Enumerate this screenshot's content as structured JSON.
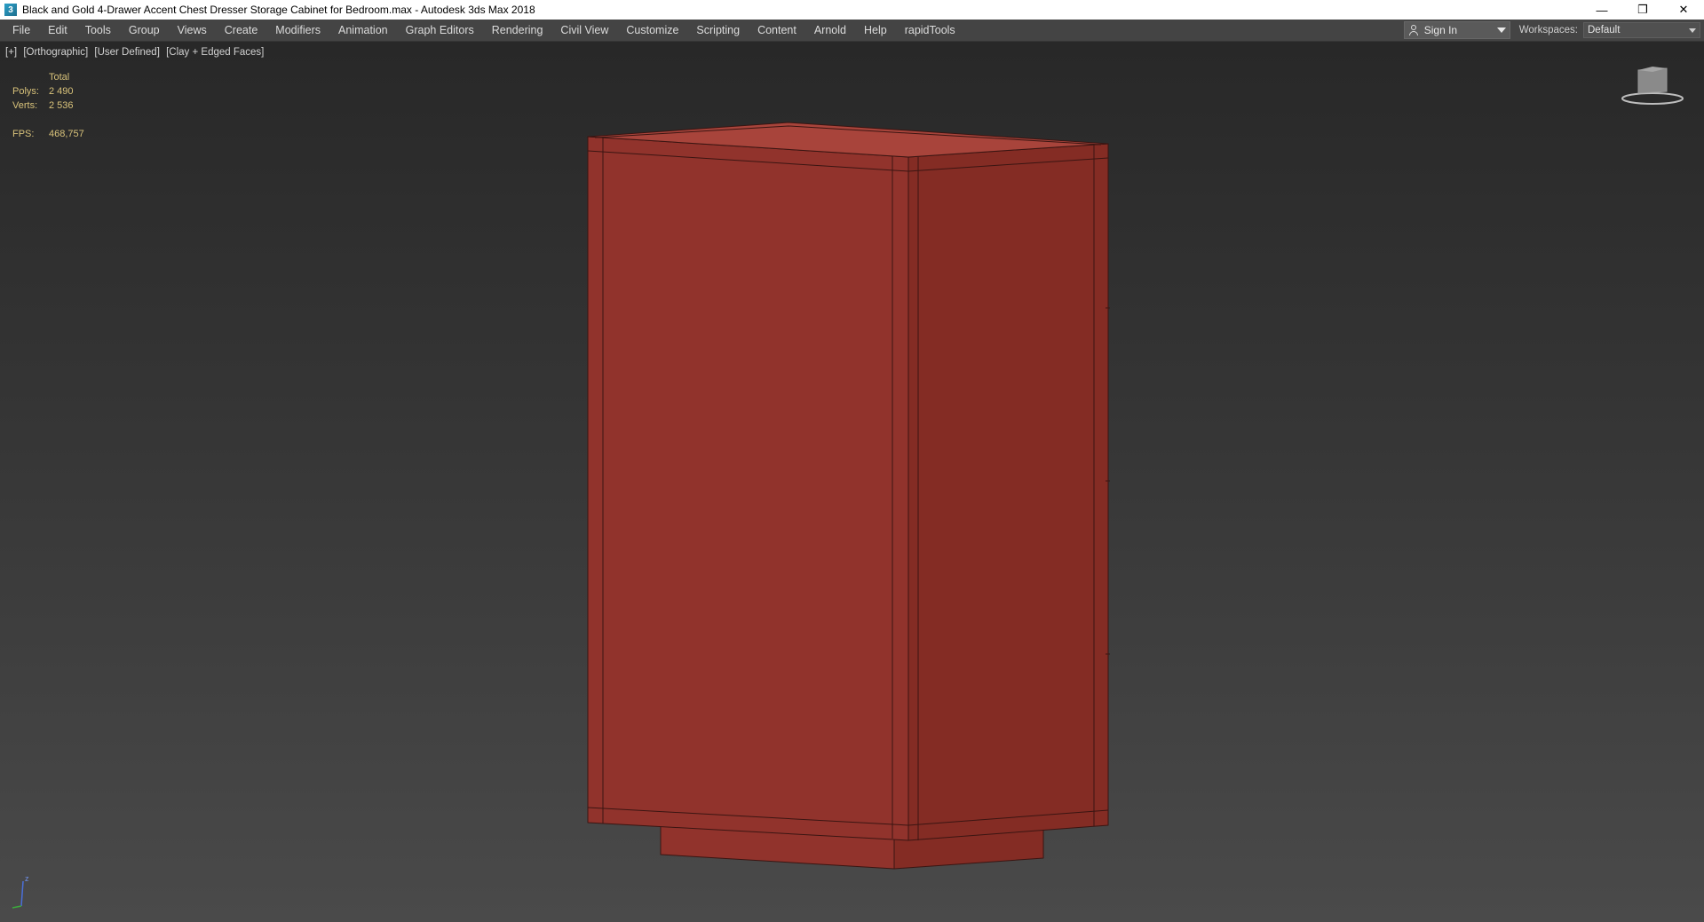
{
  "window": {
    "title": "Black and Gold 4-Drawer Accent Chest Dresser Storage Cabinet for Bedroom.max - Autodesk 3ds Max 2018",
    "app_icon_glyph": "3",
    "minimize_glyph": "—",
    "restore_glyph": "❐",
    "close_glyph": "✕"
  },
  "menu": {
    "items": [
      "File",
      "Edit",
      "Tools",
      "Group",
      "Views",
      "Create",
      "Modifiers",
      "Animation",
      "Graph Editors",
      "Rendering",
      "Civil View",
      "Customize",
      "Scripting",
      "Content",
      "Arnold",
      "Help",
      "rapidTools"
    ],
    "sign_in_label": "Sign In",
    "workspaces_label": "Workspaces:",
    "workspace_value": "Default"
  },
  "viewport": {
    "labels": [
      "[+]",
      "[Orthographic]",
      "[User Defined]",
      "[Clay + Edged Faces]"
    ],
    "stats": {
      "header": "Total",
      "polys_label": "Polys:",
      "polys_value": "2 490",
      "verts_label": "Verts:",
      "verts_value": "2 536",
      "fps_label": "FPS:",
      "fps_value": "468,757"
    },
    "axis_label": "z"
  },
  "colors": {
    "cabinet_front": "#91332c",
    "cabinet_side": "#842c24",
    "cabinet_top": "#a8443b",
    "edge": "#3a1512",
    "stats_text": "#d8c27a"
  },
  "icons": {
    "user": "user-icon",
    "viewcube": "viewcube-icon",
    "axis": "axis-tripod-icon"
  }
}
